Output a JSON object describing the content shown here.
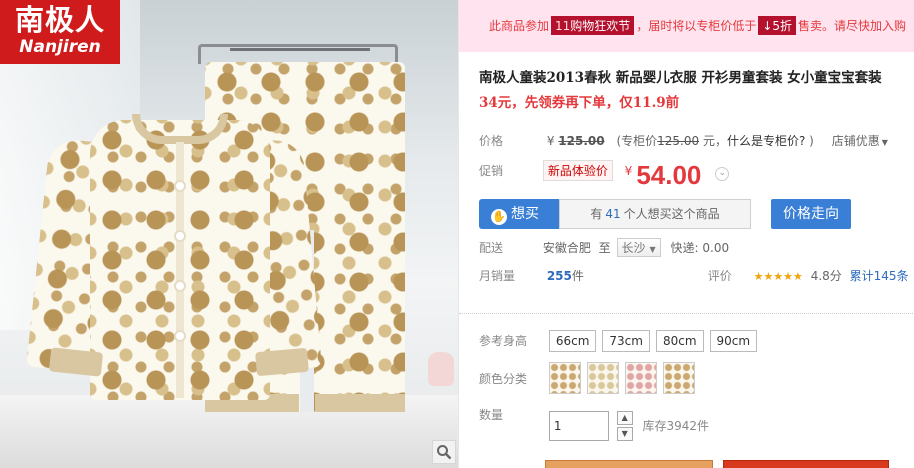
{
  "brand": {
    "name_cn": "南极人",
    "name_en": "Nanjiren"
  },
  "promo": {
    "prefix": "此商品参加",
    "event_tag_left": "1",
    "event_tag_right": "1",
    "event_name": "购物狂欢节",
    "middle": "，届时将以专柜价低于",
    "discount": "↓5折",
    "suffix": "售卖。请尽快加入购"
  },
  "product": {
    "title": "南极人童装2013春秋 新品婴儿衣服 开衫男童套装 女小童宝宝套装",
    "subtitle": "34元，先领券再下单，仅11.9前"
  },
  "price": {
    "label": "价格",
    "currency": "¥",
    "original": "125.00",
    "counter_prefix": "(专柜价",
    "counter_value": "125.00",
    "counter_suffix": "元，",
    "counter_link": "什么是专柜价?",
    "counter_close": ")",
    "store_discount": "店铺优惠"
  },
  "promotion": {
    "label": "促销",
    "tag": "新品体验价",
    "currency": "¥",
    "value": "54.00"
  },
  "want": {
    "button": "想买",
    "count_prefix": "有",
    "count": "41",
    "count_suffix": "个人想买这个商品",
    "trend_button": "价格走向"
  },
  "delivery": {
    "label": "配送",
    "from": "安徽合肥",
    "to_word": "至",
    "destination": "长沙",
    "express": "快递: 0.00"
  },
  "sales": {
    "label": "月销量",
    "count": "255",
    "unit": "件",
    "rating_label": "评价",
    "stars": "★★★★★",
    "score": "4.8分",
    "reviews_prefix": "累计",
    "reviews_count": "145",
    "reviews_suffix": "条"
  },
  "options": {
    "height_label": "参考身高",
    "sizes": [
      "66cm",
      "73cm",
      "80cm",
      "90cm"
    ],
    "color_label": "颜色分类",
    "quantity_label": "数量",
    "quantity_value": "1",
    "stock": "库存3942件"
  },
  "colors": {
    "accent_red": "#e4393c",
    "brand_red": "#cf1b1b",
    "action_blue": "#3a7fd6",
    "promo_bg": "#ffe4ef"
  }
}
